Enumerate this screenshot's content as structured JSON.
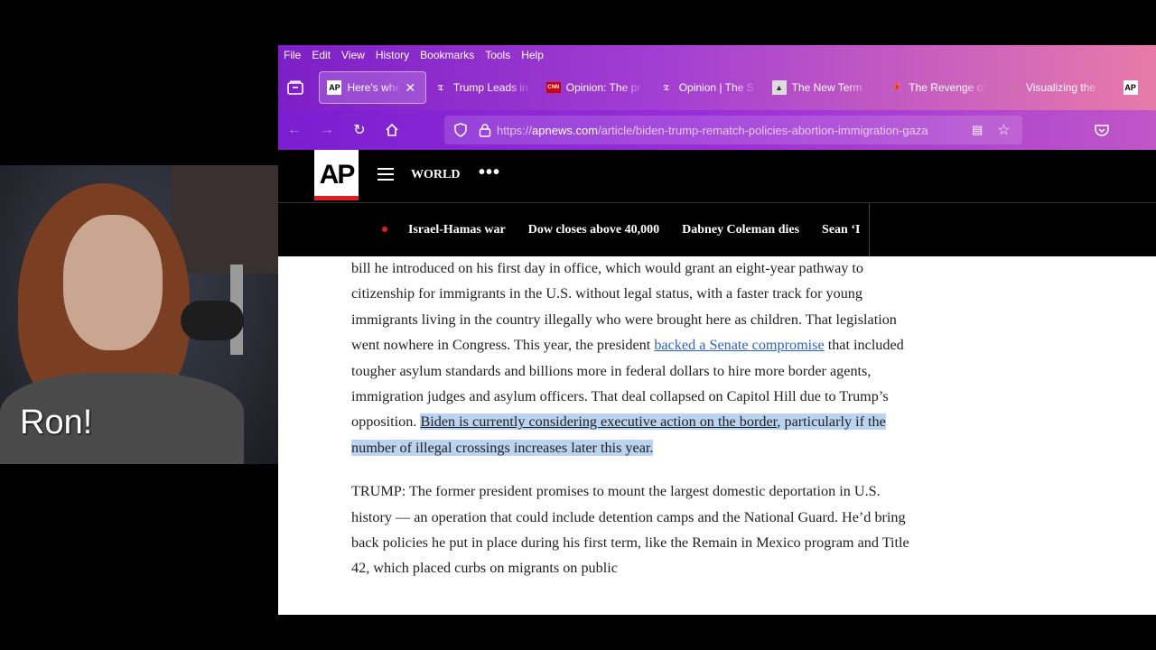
{
  "webcam": {
    "caption": "Ron!"
  },
  "menu": [
    "File",
    "Edit",
    "View",
    "History",
    "Bookmarks",
    "Tools",
    "Help"
  ],
  "tabs": [
    {
      "label": "Here's where",
      "fav": "AP",
      "active": true
    },
    {
      "label": "Trump Leads in",
      "fav": "NYT"
    },
    {
      "label": "Opinion: The pr",
      "fav": "CNN"
    },
    {
      "label": "Opinion | The S",
      "fav": "NYT"
    },
    {
      "label": "The New Term",
      "fav": "NR"
    },
    {
      "label": "The Revenge of",
      "fav": "pin"
    },
    {
      "label": "Visualizing the",
      "fav": "VC"
    },
    {
      "label": "",
      "fav": "AP"
    }
  ],
  "url": {
    "prefix": "https://",
    "host": "apnews.com",
    "path": "/article/biden-trump-rematch-policies-abortion-immigration-gaza"
  },
  "ap": {
    "logo": "AP",
    "section": "WORLD",
    "more": "•••",
    "trending": [
      "Israel-Hamas war",
      "Dow closes above 40,000",
      "Dabney Coleman dies",
      "Sean ‘I"
    ]
  },
  "article": {
    "p1_a": "bill he introduced on his first day in office, which would grant an eight-year pathway to citizenship for immigrants in the U.S. without legal status, with a faster track for young immigrants living in the country illegally who were brought here as children. That legislation went nowhere in Congress. This year, the president ",
    "p1_link": "backed a Senate compromise",
    "p1_b": " that included tougher asylum standards and billions more in federal dollars to hire more border agents, immigration judges and asylum officers. That deal collapsed on Capitol Hill due to Trump’s opposition. ",
    "p1_hl1": "Biden is currently considering executive action on the border",
    "p1_hl2": ", particularly if the number of illegal crossings increases later this year.",
    "p2": "TRUMP: The former president promises to mount the largest domestic deportation in U.S. history — an operation that could include detention camps and the National Guard. He’d bring back policies he put in place during his first term, like the Remain in Mexico program and Title 42, which placed curbs on migrants on public"
  }
}
